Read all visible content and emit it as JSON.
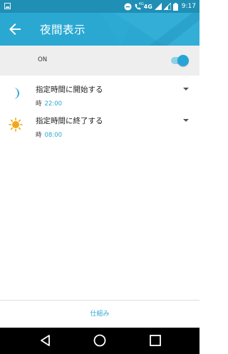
{
  "status_bar": {
    "network": "4G",
    "time": "9:17",
    "icons": [
      "image-icon",
      "dnd-icon",
      "wifi-calling-icon",
      "signal-icon",
      "signal-icon-2",
      "battery-icon"
    ],
    "wifi_calling_label": "4G"
  },
  "app_bar": {
    "title": "夜間表示",
    "back_icon": "arrow-back-icon",
    "color": "#2aa8d2"
  },
  "master": {
    "label": "ON",
    "enabled": true
  },
  "schedule": {
    "start": {
      "title": "指定時間に開始する",
      "prefix": "時",
      "time": "22:00",
      "icon": "moon-icon"
    },
    "end": {
      "title": "指定時間に終了する",
      "prefix": "時",
      "time": "08:00",
      "icon": "sun-icon"
    }
  },
  "footer": {
    "link_label": "仕組み"
  },
  "nav_bar": {
    "icons": [
      "nav-back-icon",
      "nav-home-icon",
      "nav-recents-icon"
    ]
  },
  "colors": {
    "accent": "#2aa8d2",
    "toggle_thumb": "#27a4d6",
    "sun": "#f0a818"
  }
}
